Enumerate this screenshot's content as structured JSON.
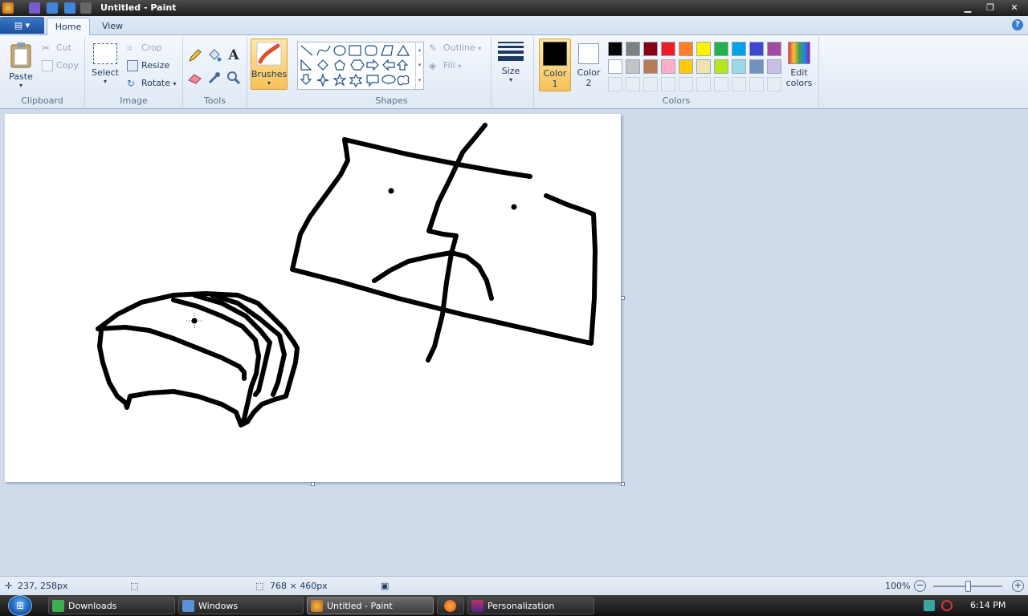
{
  "window": {
    "title": "Untitled - Paint",
    "minimize": "▁",
    "maximize": "❐",
    "close": "✕"
  },
  "tabs": {
    "home": "Home",
    "view": "View"
  },
  "help_label": "?",
  "clipboard": {
    "paste": "Paste",
    "cut": "Cut",
    "copy": "Copy",
    "group": "Clipboard"
  },
  "image": {
    "select": "Select",
    "crop": "Crop",
    "resize": "Resize",
    "rotate": "Rotate",
    "group": "Image"
  },
  "tools": {
    "group": "Tools",
    "text_tool": "A"
  },
  "brushes": {
    "label": "Brushes"
  },
  "shapes": {
    "group": "Shapes",
    "outline": "Outline",
    "fill": "Fill"
  },
  "size": {
    "label": "Size"
  },
  "colors": {
    "color1_label_a": "Color",
    "color1_label_b": "1",
    "color2_label_a": "Color",
    "color2_label_b": "2",
    "edit_a": "Edit",
    "edit_b": "colors",
    "group": "Colors",
    "color1": "#000000",
    "color2": "#ffffff",
    "palette_row1": [
      "#000000",
      "#7f7f7f",
      "#880015",
      "#ed1c24",
      "#ff7f27",
      "#fff200",
      "#22b14c",
      "#00a2e8",
      "#3f48cc",
      "#a349a4"
    ],
    "palette_row2": [
      "#ffffff",
      "#c3c3c3",
      "#b97a57",
      "#ffaec9",
      "#ffc90e",
      "#efe4b0",
      "#b5e61d",
      "#99d9ea",
      "#7092be",
      "#c8bfe7"
    ]
  },
  "status": {
    "position": "237, 258px",
    "canvas_size": "768 × 460px",
    "zoom": "100%"
  },
  "taskbar": {
    "items": [
      "Downloads",
      "Windows",
      "Untitled - Paint",
      "Personalization"
    ],
    "clock": "6:14 PM"
  }
}
